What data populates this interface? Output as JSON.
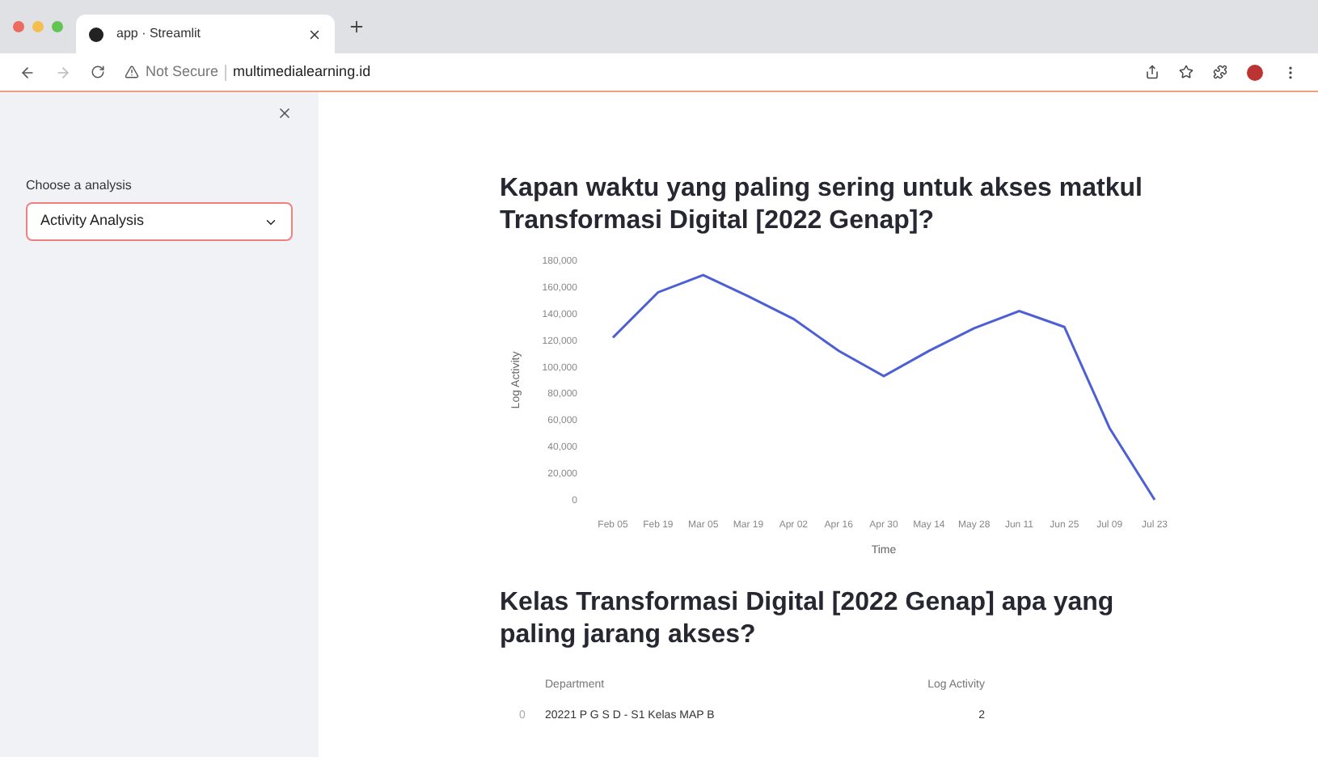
{
  "browser": {
    "tab_title": "app · Streamlit",
    "security": "Not Secure",
    "url": "multimedialearning.id"
  },
  "sidebar": {
    "label": "Choose a analysis",
    "select_value": "Activity Analysis"
  },
  "sections": [
    {
      "title": "Kapan waktu yang paling sering untuk akses matkul Transformasi Digital [2022 Genap]?",
      "chart_data": {
        "type": "line",
        "xlabel": "Time",
        "ylabel": "Log Activity",
        "categories": [
          "Feb 05",
          "Feb 19",
          "Mar 05",
          "Mar 19",
          "Apr 02",
          "Apr 16",
          "Apr 30",
          "May 14",
          "May 28",
          "Jun 11",
          "Jun 25",
          "Jul 09",
          "Jul 23"
        ],
        "series": [
          {
            "color": "#4c5fd5",
            "values": [
              122000,
              156000,
              169000,
              153000,
              136000,
              112000,
              93000,
              112000,
              129000,
              142000,
              130000,
              54000,
              0
            ]
          }
        ],
        "ylim": [
          0,
          180000
        ],
        "yticks": [
          {
            "value": 0,
            "label": "0"
          },
          {
            "value": 20000,
            "label": "20,000"
          },
          {
            "value": 40000,
            "label": "40,000"
          },
          {
            "value": 60000,
            "label": "60,000"
          },
          {
            "value": 80000,
            "label": "80,000"
          },
          {
            "value": 100000,
            "label": "100,000"
          },
          {
            "value": 120000,
            "label": "120,000"
          },
          {
            "value": 140000,
            "label": "140,000"
          },
          {
            "value": 160000,
            "label": "160,000"
          },
          {
            "value": 180000,
            "label": "180,000"
          }
        ]
      }
    },
    {
      "title": "Kelas Transformasi Digital [2022 Genap] apa yang paling jarang akses?",
      "table": {
        "columns": [
          "",
          "Department",
          "Log Activity"
        ],
        "rows": [
          [
            "0",
            "20221 P G S D - S1 Kelas MAP B",
            "2"
          ]
        ]
      }
    }
  ]
}
